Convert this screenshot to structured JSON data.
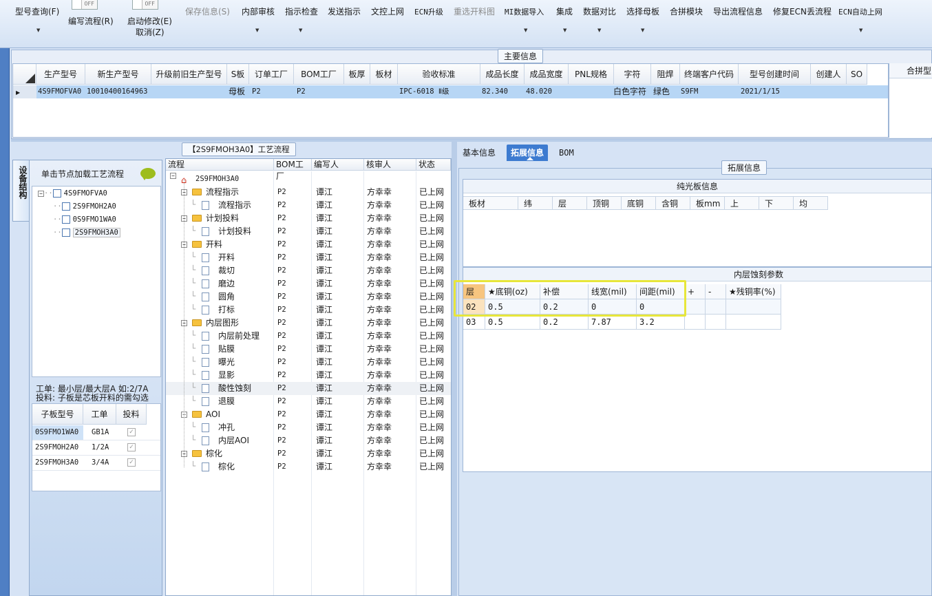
{
  "toolbar": {
    "items": [
      {
        "label": "型号查询(F)",
        "disabled": false,
        "dropdown": true
      },
      {
        "label": "编写流程(R)",
        "disabled": false,
        "dropdown": false
      },
      {
        "label": "启动修改(E)",
        "disabled": false,
        "dropdown": false
      },
      {
        "label": "取消(Z)",
        "disabled": false,
        "dropdown": false
      },
      {
        "label": "保存信息(S)",
        "disabled": true,
        "dropdown": false
      },
      {
        "label": "内部审核",
        "disabled": false,
        "dropdown": true
      },
      {
        "label": "指示检查",
        "disabled": false,
        "dropdown": true
      },
      {
        "label": "发送指示",
        "disabled": false,
        "dropdown": false
      },
      {
        "label": "文控上网",
        "disabled": false,
        "dropdown": false
      },
      {
        "label": "ECN升级",
        "disabled": false,
        "dropdown": false
      },
      {
        "label": "重选开料图",
        "disabled": true,
        "dropdown": false
      },
      {
        "label": "MI数据导入",
        "disabled": false,
        "dropdown": true
      },
      {
        "label": "集成",
        "disabled": false,
        "dropdown": true
      },
      {
        "label": "数据对比",
        "disabled": false,
        "dropdown": true
      },
      {
        "label": "选择母板",
        "disabled": false,
        "dropdown": true
      },
      {
        "label": "合拼模块",
        "disabled": false,
        "dropdown": false
      },
      {
        "label": "导出流程信息",
        "disabled": false,
        "dropdown": false
      },
      {
        "label": "修复ECN丢流程",
        "disabled": false,
        "dropdown": false
      },
      {
        "label": "ECN自动上网",
        "disabled": false,
        "dropdown": true
      }
    ],
    "toggle1": "OFF",
    "toggle2": "OFF"
  },
  "main_info": {
    "title": "主要信息",
    "columns": [
      "生产型号",
      "新生产型号",
      "升级前旧生产型号",
      "S板",
      "订单工厂",
      "BOM工厂",
      "板厚",
      "板材",
      "验收标准",
      "成品长度",
      "成品宽度",
      "PNL规格",
      "字符",
      "阻焊",
      "终端客户代码",
      "型号创建时间",
      "创建人",
      "SO"
    ],
    "row": [
      "4S9FMOFVA0",
      "10010400164963",
      "",
      "母板",
      "P2",
      "P2",
      "",
      "",
      "IPC-6018 Ⅱ级",
      "82.340",
      "48.020",
      "",
      "白色字符",
      "绿色",
      "S9FM",
      "2021/1/15",
      "",
      ""
    ],
    "side_header": "合拼型"
  },
  "device_tab": "设备结构",
  "left_panel": {
    "hint": "单击节点加载工艺流程",
    "tree": [
      "4S9FMOFVA0",
      "2S9FMOH2A0",
      "0S9FMO1WA0",
      "2S9FMOH3A0"
    ],
    "note1": "工单: 最小层/最大层A 如:2/7A",
    "note2": "投料: 子板是芯板开料的需勾选",
    "sub_columns": [
      "子板型号",
      "工单",
      "投料"
    ],
    "sub_rows": [
      [
        "0S9FMO1WA0",
        "GB1A"
      ],
      [
        "2S9FMOH2A0",
        "1/2A"
      ],
      [
        "2S9FMOH3A0",
        "3/4A"
      ]
    ]
  },
  "flow": {
    "title": "【2S9FMOH3A0】工艺流程",
    "columns": [
      "流程",
      "BOM工厂",
      "编写人",
      "核审人",
      "状态"
    ],
    "root": "2S9FMOH3A0",
    "rows": [
      {
        "name": "流程指示",
        "level": 1,
        "bom": "P2",
        "writer": "谭江",
        "reviewer": "方幸幸",
        "status": "已上网"
      },
      {
        "name": "流程指示",
        "level": 2,
        "bom": "P2",
        "writer": "谭江",
        "reviewer": "方幸幸",
        "status": "已上网"
      },
      {
        "name": "计划投料",
        "level": 1,
        "bom": "P2",
        "writer": "谭江",
        "reviewer": "方幸幸",
        "status": "已上网"
      },
      {
        "name": "计划投料",
        "level": 2,
        "bom": "P2",
        "writer": "谭江",
        "reviewer": "方幸幸",
        "status": "已上网"
      },
      {
        "name": "开料",
        "level": 1,
        "bom": "P2",
        "writer": "谭江",
        "reviewer": "方幸幸",
        "status": "已上网"
      },
      {
        "name": "开料",
        "level": 2,
        "bom": "P2",
        "writer": "谭江",
        "reviewer": "方幸幸",
        "status": "已上网"
      },
      {
        "name": "裁切",
        "level": 2,
        "bom": "P2",
        "writer": "谭江",
        "reviewer": "方幸幸",
        "status": "已上网"
      },
      {
        "name": "磨边",
        "level": 2,
        "bom": "P2",
        "writer": "谭江",
        "reviewer": "方幸幸",
        "status": "已上网"
      },
      {
        "name": "圆角",
        "level": 2,
        "bom": "P2",
        "writer": "谭江",
        "reviewer": "方幸幸",
        "status": "已上网"
      },
      {
        "name": "打标",
        "level": 2,
        "bom": "P2",
        "writer": "谭江",
        "reviewer": "方幸幸",
        "status": "已上网"
      },
      {
        "name": "内层图形",
        "level": 1,
        "bom": "P2",
        "writer": "谭江",
        "reviewer": "方幸幸",
        "status": "已上网"
      },
      {
        "name": "内层前处理",
        "level": 2,
        "bom": "P2",
        "writer": "谭江",
        "reviewer": "方幸幸",
        "status": "已上网"
      },
      {
        "name": "贴膜",
        "level": 2,
        "bom": "P2",
        "writer": "谭江",
        "reviewer": "方幸幸",
        "status": "已上网"
      },
      {
        "name": "曝光",
        "level": 2,
        "bom": "P2",
        "writer": "谭江",
        "reviewer": "方幸幸",
        "status": "已上网"
      },
      {
        "name": "显影",
        "level": 2,
        "bom": "P2",
        "writer": "谭江",
        "reviewer": "方幸幸",
        "status": "已上网"
      },
      {
        "name": "酸性蚀刻",
        "level": 2,
        "bom": "P2",
        "writer": "谭江",
        "reviewer": "方幸幸",
        "status": "已上网"
      },
      {
        "name": "退膜",
        "level": 2,
        "bom": "P2",
        "writer": "谭江",
        "reviewer": "方幸幸",
        "status": "已上网"
      },
      {
        "name": "AOI",
        "level": 1,
        "bom": "P2",
        "writer": "谭江",
        "reviewer": "方幸幸",
        "status": "已上网"
      },
      {
        "name": "冲孔",
        "level": 2,
        "bom": "P2",
        "writer": "谭江",
        "reviewer": "方幸幸",
        "status": "已上网"
      },
      {
        "name": "内层AOI",
        "level": 2,
        "bom": "P2",
        "writer": "谭江",
        "reviewer": "方幸幸",
        "status": "已上网"
      },
      {
        "name": "棕化",
        "level": 1,
        "bom": "P2",
        "writer": "谭江",
        "reviewer": "方幸幸",
        "status": "已上网"
      },
      {
        "name": "棕化",
        "level": 2,
        "bom": "P2",
        "writer": "谭江",
        "reviewer": "方幸幸",
        "status": "已上网"
      }
    ]
  },
  "tabs": [
    "基本信息",
    "拓展信息",
    "BOM"
  ],
  "ext_title": "拓展信息",
  "plain_board": {
    "title": "纯光板信息",
    "columns": [
      "板材",
      "纬",
      "层",
      "顶铜",
      "底铜",
      "含铜",
      "板mm",
      "上",
      "下",
      "均"
    ]
  },
  "etch": {
    "title": "内层蚀刻参数",
    "columns": [
      "层",
      "★底铜(oz)",
      "补偿",
      "线宽(mil)",
      "间距(mil)",
      "+",
      "-",
      "★残铜率(%)"
    ],
    "rows": [
      [
        "02",
        "0.5",
        "0.2",
        "0",
        "0"
      ],
      [
        "03",
        "0.5",
        "0.2",
        "7.87",
        "3.2"
      ]
    ]
  },
  "colors": {
    "accent": "#3d7bd0",
    "selected_row": "#b7d6f5",
    "highlight": "#e7e63a"
  }
}
